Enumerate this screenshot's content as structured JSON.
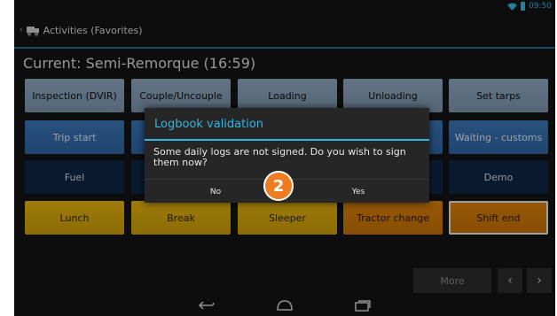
{
  "status_bar": {
    "time": "09:50",
    "icons": [
      "wifi-icon",
      "battery-icon"
    ],
    "accent": "#33b5e5"
  },
  "action_bar": {
    "back_caret": "‹",
    "app_icon": "truck-app-icon",
    "title": "Activities (Favorites)"
  },
  "current": {
    "text": "Current: Semi-Remorque (16:59)"
  },
  "activities": [
    [
      {
        "label": "Inspection (DVIR)",
        "style": "gray"
      },
      {
        "label": "Couple/Uncouple",
        "style": "gray"
      },
      {
        "label": "Loading",
        "style": "gray"
      },
      {
        "label": "Unloading",
        "style": "gray"
      },
      {
        "label": "Set tarps",
        "style": "gray"
      }
    ],
    [
      {
        "label": "Trip start",
        "style": "blue"
      },
      {
        "label": "",
        "style": "blue"
      },
      {
        "label": "",
        "style": "blue"
      },
      {
        "label": "",
        "style": "blue"
      },
      {
        "label": "Waiting - customs",
        "style": "blue"
      }
    ],
    [
      {
        "label": "Fuel",
        "style": "navy"
      },
      {
        "label": "",
        "style": "navy"
      },
      {
        "label": "",
        "style": "navy"
      },
      {
        "label": "",
        "style": "navy"
      },
      {
        "label": "Demo",
        "style": "navy"
      }
    ],
    [
      {
        "label": "Lunch",
        "style": "gold"
      },
      {
        "label": "Break",
        "style": "gold"
      },
      {
        "label": "Sleeper",
        "style": "gold"
      },
      {
        "label": "Tractor change",
        "style": "orange"
      },
      {
        "label": "Shift end",
        "style": "orange-selected"
      }
    ]
  ],
  "bottom_bar": {
    "more": "More",
    "prev": "‹",
    "next": "›"
  },
  "nav_bar": {
    "icons": [
      "back-icon",
      "home-icon",
      "recents-icon"
    ]
  },
  "dialog": {
    "title": "Logbook validation",
    "message": "Some daily logs are not signed. Do you wish to sign them now?",
    "no": "No",
    "yes": "Yes"
  },
  "callout": {
    "number": "2",
    "color": "#ee7d22"
  }
}
